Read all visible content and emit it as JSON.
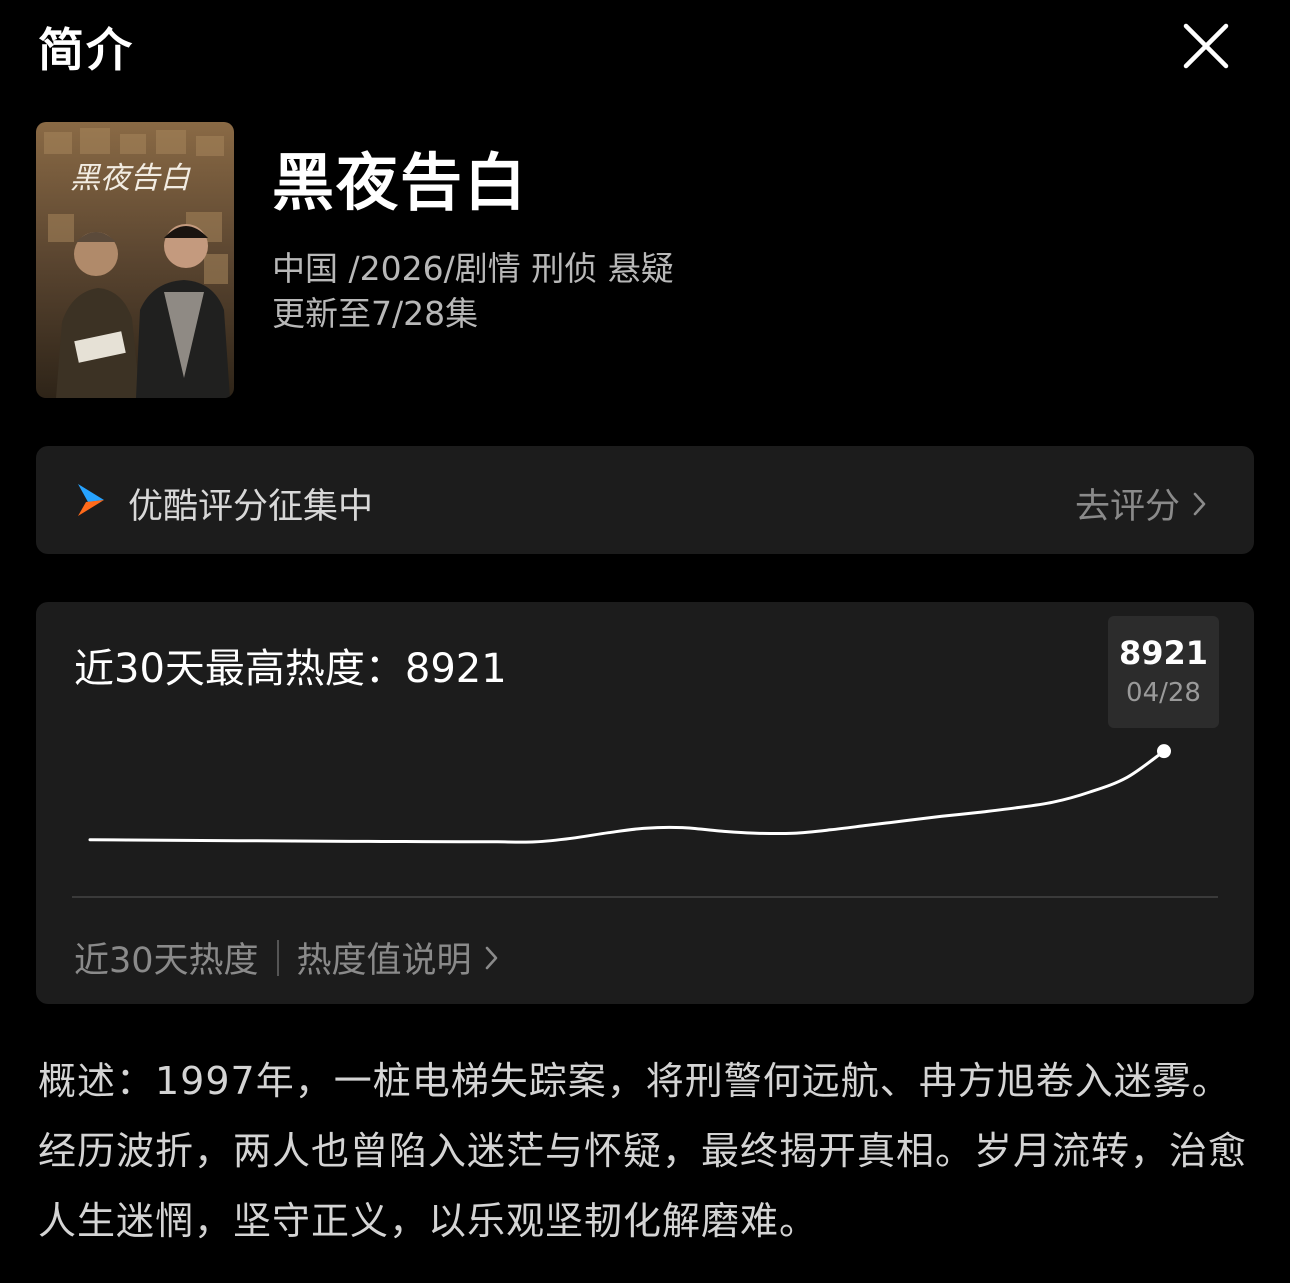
{
  "header": {
    "title": "简介",
    "close_icon": "close-icon"
  },
  "show": {
    "title": "黑夜告白",
    "meta": "中国 /2026/剧情 刑侦 悬疑",
    "update_status": "更新至7/28集",
    "poster_title": "黑夜告白"
  },
  "rating": {
    "label": "优酷评分征集中",
    "action": "去评分",
    "logo_icon": "youku-play-icon",
    "arrow_icon": "chevron-right-icon"
  },
  "heat": {
    "title": "近30天最高热度：8921",
    "tooltip_value": "8921",
    "tooltip_date": "04/28",
    "footer_label": "近30天热度",
    "footer_link": "热度值说明"
  },
  "chart_data": {
    "type": "line",
    "title": "近30天最高热度：8921",
    "xlabel": "",
    "ylabel": "",
    "grid": false,
    "x": [
      1,
      2,
      3,
      4,
      5,
      6,
      7,
      8,
      9,
      10,
      11,
      12,
      13,
      14,
      15,
      16,
      17,
      18,
      19,
      20,
      21,
      22,
      23,
      24,
      25,
      26,
      27,
      28,
      29,
      30
    ],
    "series": [
      {
        "values": [
          1070,
          1050,
          1030,
          1010,
          990,
          970,
          950,
          930,
          920,
          910,
          900,
          890,
          880,
          1200,
          1700,
          2100,
          2150,
          1850,
          1650,
          1650,
          1950,
          2350,
          2750,
          3150,
          3500,
          3900,
          4400,
          5300,
          6600,
          8921
        ]
      }
    ],
    "ylim": [
      -4000,
      10000
    ],
    "highlight": {
      "x": 30,
      "value": 8921,
      "label": "04/28"
    }
  },
  "summary": {
    "text": "概述：1997年，一桩电梯失踪案，将刑警何远航、冉方旭卷入迷雾。经历波折，两人也曾陷入迷茫与怀疑，最终揭开真相。岁月流转，治愈人生迷惘，坚守正义，以乐观坚韧化解磨难。"
  }
}
